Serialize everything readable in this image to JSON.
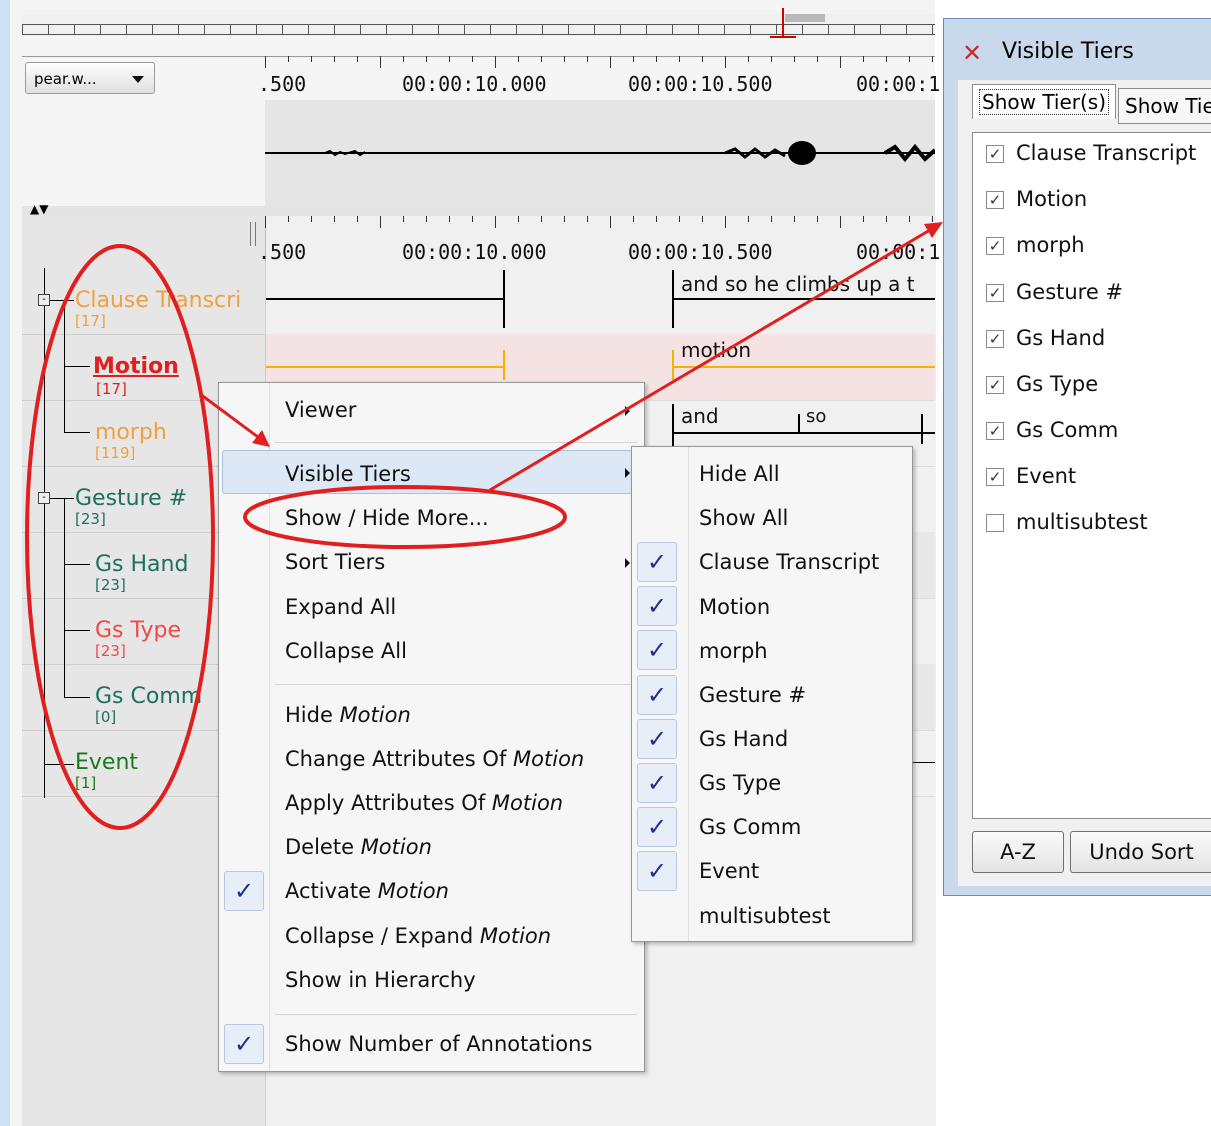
{
  "media_select": {
    "value": "pear.w..."
  },
  "timeline": {
    "labels": [
      ".500",
      "00:00:10.000",
      "00:00:10.500",
      "00:00:1"
    ]
  },
  "tiers": [
    {
      "name": "Clause Transcri",
      "count": "[17]",
      "color": "#f0a040"
    },
    {
      "name": "Motion",
      "count": "[17]",
      "color": "#e02020"
    },
    {
      "name": "morph",
      "count": "[119]",
      "color": "#f0a040"
    },
    {
      "name": "Gesture #",
      "count": "[23]",
      "color": "#1f6f5f"
    },
    {
      "name": "Gs Hand",
      "count": "[23]",
      "color": "#1f6f5f"
    },
    {
      "name": "Gs Type",
      "count": "[23]",
      "color": "#f04848"
    },
    {
      "name": "Gs Comm",
      "count": "[0]",
      "color": "#1f6f5f"
    },
    {
      "name": "Event",
      "count": "[1]",
      "color": "#1a7a1a"
    }
  ],
  "annotations": {
    "clause": "and so he climbs up a t",
    "motion": "motion",
    "morph_1": "and",
    "morph_2": "so"
  },
  "context_menu": {
    "viewer": "Viewer",
    "visible_tiers": "Visible Tiers",
    "show_hide_more": "Show / Hide More...",
    "sort_tiers": "Sort Tiers",
    "expand_all": "Expand All",
    "collapse_all": "Collapse All",
    "hide_prefix": "Hide ",
    "change_attr_prefix": "Change Attributes Of ",
    "apply_attr_prefix": "Apply Attributes Of ",
    "delete_prefix": "Delete ",
    "activate_prefix": "Activate ",
    "collapse_expand_prefix": "Collapse / Expand ",
    "tier_name": "Motion",
    "show_in_hierarchy": "Show in Hierarchy",
    "show_number": "Show Number of Annotations"
  },
  "submenu": {
    "hide_all": "Hide All",
    "show_all": "Show All",
    "items": [
      {
        "label": "Clause Transcript",
        "checked": true
      },
      {
        "label": "Motion",
        "checked": true
      },
      {
        "label": "morph",
        "checked": true
      },
      {
        "label": "Gesture #",
        "checked": true
      },
      {
        "label": "Gs Hand",
        "checked": true
      },
      {
        "label": "Gs Type",
        "checked": true
      },
      {
        "label": "Gs Comm",
        "checked": true
      },
      {
        "label": "Event",
        "checked": true
      },
      {
        "label": "multisubtest",
        "checked": false
      }
    ]
  },
  "dialog": {
    "title": "Visible Tiers",
    "tab_1": "Show Tier(s)",
    "tab_2": "Show Tie",
    "items": [
      {
        "label": "Clause Transcript",
        "checked": true
      },
      {
        "label": "Motion",
        "checked": true
      },
      {
        "label": "morph",
        "checked": true
      },
      {
        "label": "Gesture #",
        "checked": true
      },
      {
        "label": "Gs Hand",
        "checked": true
      },
      {
        "label": "Gs Type",
        "checked": true
      },
      {
        "label": "Gs Comm",
        "checked": true
      },
      {
        "label": "Event",
        "checked": true
      },
      {
        "label": "multisubtest",
        "checked": false
      }
    ],
    "btn_az": "A-Z",
    "btn_undo": "Undo Sort"
  },
  "colors": {
    "annotation_red": "#e02020",
    "highlight": "#f5e3e3",
    "check_blue": "#1b2f8f"
  }
}
